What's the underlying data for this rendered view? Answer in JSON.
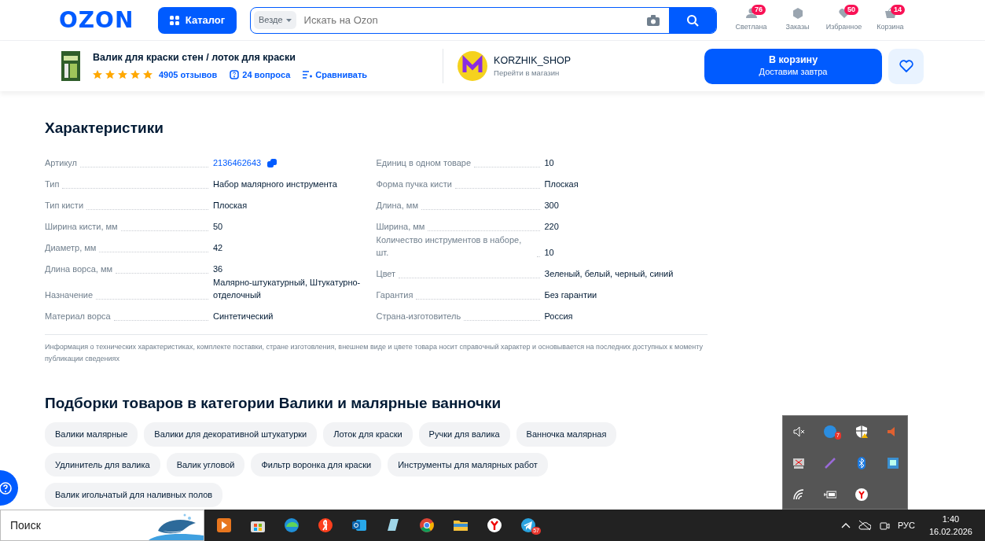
{
  "header": {
    "logo": "OZON",
    "catalog_button": "Каталог",
    "search": {
      "scope": "Везде",
      "placeholder": "Искать на Ozon"
    },
    "nav": [
      {
        "kind": "user",
        "label": "Светлана",
        "badge": "76"
      },
      {
        "kind": "orders",
        "label": "Заказы"
      },
      {
        "kind": "favorites",
        "label": "Избранное",
        "badge": "50"
      },
      {
        "kind": "cart",
        "label": "Корзина",
        "badge": "14"
      }
    ]
  },
  "product_bar": {
    "title": "Валик для краски стен / лоток для краски",
    "stars": 5,
    "reviews": "4905 отзывов",
    "questions": "24 вопроса",
    "compare": "Сравнивать",
    "seller": {
      "name": "KORZHIK_SHOP",
      "link": "Перейти в магазин"
    },
    "cart_button": {
      "label": "В корзину",
      "sublabel": "Доставим завтра"
    }
  },
  "characteristics": {
    "title": "Характеристики",
    "columns": [
      [
        {
          "kind": "link",
          "label": "Артикул",
          "value": "2136462643"
        },
        {
          "kind": "text",
          "label": "Тип",
          "value": "Набор малярного инструмента"
        },
        {
          "kind": "text",
          "label": "Тип кисти",
          "value": "Плоская"
        },
        {
          "kind": "text",
          "label": "Ширина кисти, мм",
          "value": "50"
        },
        {
          "kind": "text",
          "label": "Диаметр, мм",
          "value": "42"
        },
        {
          "kind": "text",
          "label": "Длина ворса, мм",
          "value": "36"
        },
        {
          "kind": "text",
          "label": "Назначение",
          "value": "Малярно-штукатурный, Штукатурно-отделочный"
        },
        {
          "kind": "text",
          "label": "Материал ворса",
          "value": "Синтетический"
        }
      ],
      [
        {
          "kind": "text",
          "label": "Единиц в одном товаре",
          "value": "10"
        },
        {
          "kind": "text",
          "label": "Форма пучка кисти",
          "value": "Плоская"
        },
        {
          "kind": "text",
          "label": "Длина, мм",
          "value": "300"
        },
        {
          "kind": "text",
          "label": "Ширина, мм",
          "value": "220"
        },
        {
          "kind": "text",
          "label": "Количество инструментов в наборе, шт.",
          "value": "10"
        },
        {
          "kind": "text",
          "label": "Цвет",
          "value": "Зеленый, белый, черный, синий"
        },
        {
          "kind": "text",
          "label": "Гарантия",
          "value": "Без гарантии"
        },
        {
          "kind": "text",
          "label": "Страна-изготовитель",
          "value": "Россия"
        }
      ]
    ],
    "note": "Информация о технических характеристиках, комплекте поставки, стране изготовления, внешнем виде и цвете товара носит справочный характер и основывается на последних доступных к моменту публикации сведениях"
  },
  "collections": {
    "title": "Подборки товаров в категории Валики и малярные ванночки",
    "tags": [
      "Валики малярные",
      "Валики для декоративной штукатурки",
      "Лоток для краски",
      "Ручки для валика",
      "Ванночка малярная",
      "Удлинитель для валика",
      "Валик угловой",
      "Фильтр воронка для краски",
      "Инструменты для малярных работ",
      "Валик игольчатый для наливных полов"
    ]
  },
  "tray_popup": {
    "badge": "7"
  },
  "taskbar": {
    "search": "Поиск",
    "apps": [
      {
        "kind": "media"
      },
      {
        "kind": "store"
      },
      {
        "kind": "edge"
      },
      {
        "kind": "yandex"
      },
      {
        "kind": "outlook"
      },
      {
        "kind": "notes"
      },
      {
        "kind": "chrome"
      },
      {
        "kind": "folder"
      },
      {
        "kind": "ybrowser"
      },
      {
        "kind": "telegram",
        "badge": "57"
      }
    ],
    "language": "РУС",
    "time": "1:40",
    "date": "16.02.2026"
  }
}
